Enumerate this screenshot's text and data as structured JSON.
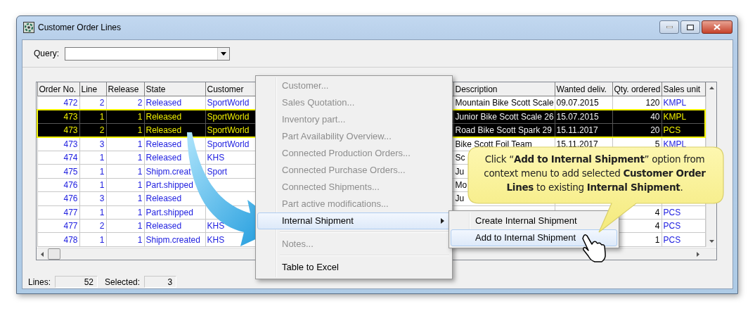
{
  "window": {
    "title": "Customer Order Lines"
  },
  "query": {
    "label": "Query:"
  },
  "table": {
    "columns": [
      "Order No.",
      "Line",
      "Release",
      "State",
      "Customer",
      "Description",
      "Wanted deliv.",
      "Qty. ordered",
      "Sales unit"
    ],
    "rows": [
      {
        "cells": [
          "472",
          "2",
          "2",
          "Released",
          "SportWorld",
          "Mountain Bike Scott Scale",
          "09.07.2015",
          "120",
          "KMPL"
        ],
        "selected": false
      },
      {
        "cells": [
          "473",
          "1",
          "1",
          "Released",
          "SportWorld",
          "Junior Bike Scott Scale 26",
          "15.07.2015",
          "40",
          "KMPL"
        ],
        "selected": true
      },
      {
        "cells": [
          "473",
          "2",
          "1",
          "Released",
          "SportWorld",
          "Road Bike Scott Spark 29",
          "15.11.2017",
          "20",
          "PCS"
        ],
        "selected": true
      },
      {
        "cells": [
          "473",
          "3",
          "1",
          "Released",
          "SportWorld",
          "Bike Scott Foil Team",
          "15.11.2017",
          "5",
          "KMPL"
        ],
        "selected": false
      },
      {
        "cells": [
          "474",
          "1",
          "1",
          "Released",
          "KHS",
          "Sc",
          null,
          null,
          null
        ],
        "selected": false
      },
      {
        "cells": [
          "475",
          "1",
          "1",
          "Shipm.creat",
          "Sport",
          "Ju",
          null,
          null,
          null
        ],
        "selected": false
      },
      {
        "cells": [
          "476",
          "1",
          "1",
          "Part.shipped",
          null,
          "Mo",
          null,
          null,
          null
        ],
        "selected": false
      },
      {
        "cells": [
          "476",
          "3",
          "1",
          "Released",
          null,
          "Ju",
          null,
          null,
          null
        ],
        "selected": false
      },
      {
        "cells": [
          "477",
          "1",
          "1",
          "Part.shipped",
          null,
          null,
          null,
          "4",
          "PCS"
        ],
        "selected": false
      },
      {
        "cells": [
          "477",
          "2",
          "1",
          "Released",
          "KHS",
          null,
          null,
          "4",
          "PCS"
        ],
        "selected": false
      },
      {
        "cells": [
          "478",
          "1",
          "1",
          "Shipm.created",
          "KHS",
          null,
          null,
          "1",
          "PCS"
        ],
        "selected": false
      }
    ]
  },
  "context_menu": {
    "items": [
      {
        "kind": "item",
        "label": "Customer...",
        "disabled": true,
        "selected": false
      },
      {
        "kind": "item",
        "label": "Sales Quotation...",
        "disabled": true,
        "selected": false
      },
      {
        "kind": "item",
        "label": "Inventory part...",
        "disabled": true,
        "selected": false
      },
      {
        "kind": "item",
        "label": "Part Availability Overview...",
        "disabled": true,
        "selected": false
      },
      {
        "kind": "item",
        "label": "Connected Production Orders...",
        "disabled": true,
        "selected": false
      },
      {
        "kind": "item",
        "label": "Connected Purchase Orders...",
        "disabled": true,
        "selected": false
      },
      {
        "kind": "item",
        "label": "Connected Shipments...",
        "disabled": true,
        "selected": false
      },
      {
        "kind": "item",
        "label": "Part active modifications...",
        "disabled": true,
        "selected": false
      },
      {
        "kind": "submenu",
        "label": "Internal Shipment",
        "disabled": false,
        "selected": true
      },
      {
        "kind": "separator"
      },
      {
        "kind": "item",
        "label": "Notes...",
        "disabled": true,
        "selected": false
      },
      {
        "kind": "separator"
      },
      {
        "kind": "item",
        "label": "Table to Excel",
        "disabled": false,
        "selected": false
      }
    ]
  },
  "submenu": {
    "items": [
      {
        "label": "Create Internal Shipment",
        "selected": false
      },
      {
        "label": "Add to Internal Shipment",
        "selected": true
      }
    ]
  },
  "callout": {
    "text": "Click “**Add to Internal Shipment**” option from context menu to add selected **Customer Order Lines** to existing **Internal Shipment**."
  },
  "status_bar": {
    "lines_label": "Lines:",
    "lines": "52",
    "selected_label": "Selected:",
    "selected": "3"
  }
}
